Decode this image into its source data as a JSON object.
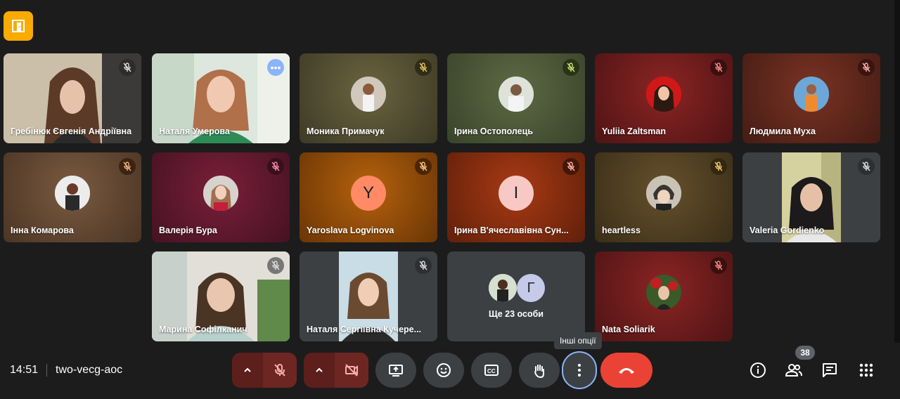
{
  "tiles": [
    {
      "name": "Гребінюк Євгенія Андріївна",
      "muted": true
    },
    {
      "name": "Наталя Умерова",
      "muted": false
    },
    {
      "name": "Моника Примачук",
      "muted": true
    },
    {
      "name": "Ірина Остополець",
      "muted": true
    },
    {
      "name": "Yuliia Zaltsman",
      "muted": true
    },
    {
      "name": "Людмила Муха",
      "muted": true
    },
    {
      "name": "Інна Комарова",
      "muted": true
    },
    {
      "name": "Валерія Бура",
      "muted": true
    },
    {
      "name": "Yaroslava Logvinova",
      "muted": true,
      "initial": "Y"
    },
    {
      "name": "Ірина В'ячеславівна Сун...",
      "muted": true,
      "initial": "I"
    },
    {
      "name": "heartless",
      "muted": true
    },
    {
      "name": "Valeria Gordienko",
      "muted": true
    },
    {
      "name": "Марина Софілканич",
      "muted": true
    },
    {
      "name": "Наталя Сергіївна Кучере...",
      "muted": true
    },
    {
      "name": "Ще 23 особи",
      "avatar_letter": "Г"
    },
    {
      "name": "Nata Soliarik",
      "muted": true
    }
  ],
  "bottom_bar": {
    "time": "14:51",
    "meeting_code": "two-vecg-aoc",
    "more_options_tooltip": "Інші опції",
    "participants_count": "38"
  },
  "icons": {
    "app": "meet-door-icon",
    "mic": "mic-off-icon",
    "camera": "camera-off-icon",
    "present": "present-screen-icon",
    "emoji": "emoji-icon",
    "captions": "captions-icon",
    "hand": "raise-hand-icon",
    "more": "more-vert-icon",
    "leave": "end-call-icon",
    "info": "info-icon",
    "people": "people-icon",
    "chat": "chat-icon",
    "activities": "apps-grid-icon"
  },
  "colors": {
    "accent": "#8ab4f8",
    "leave": "#ea4335",
    "mic_off_bg": "#5c1f1c",
    "brand": "#f9ab00"
  }
}
